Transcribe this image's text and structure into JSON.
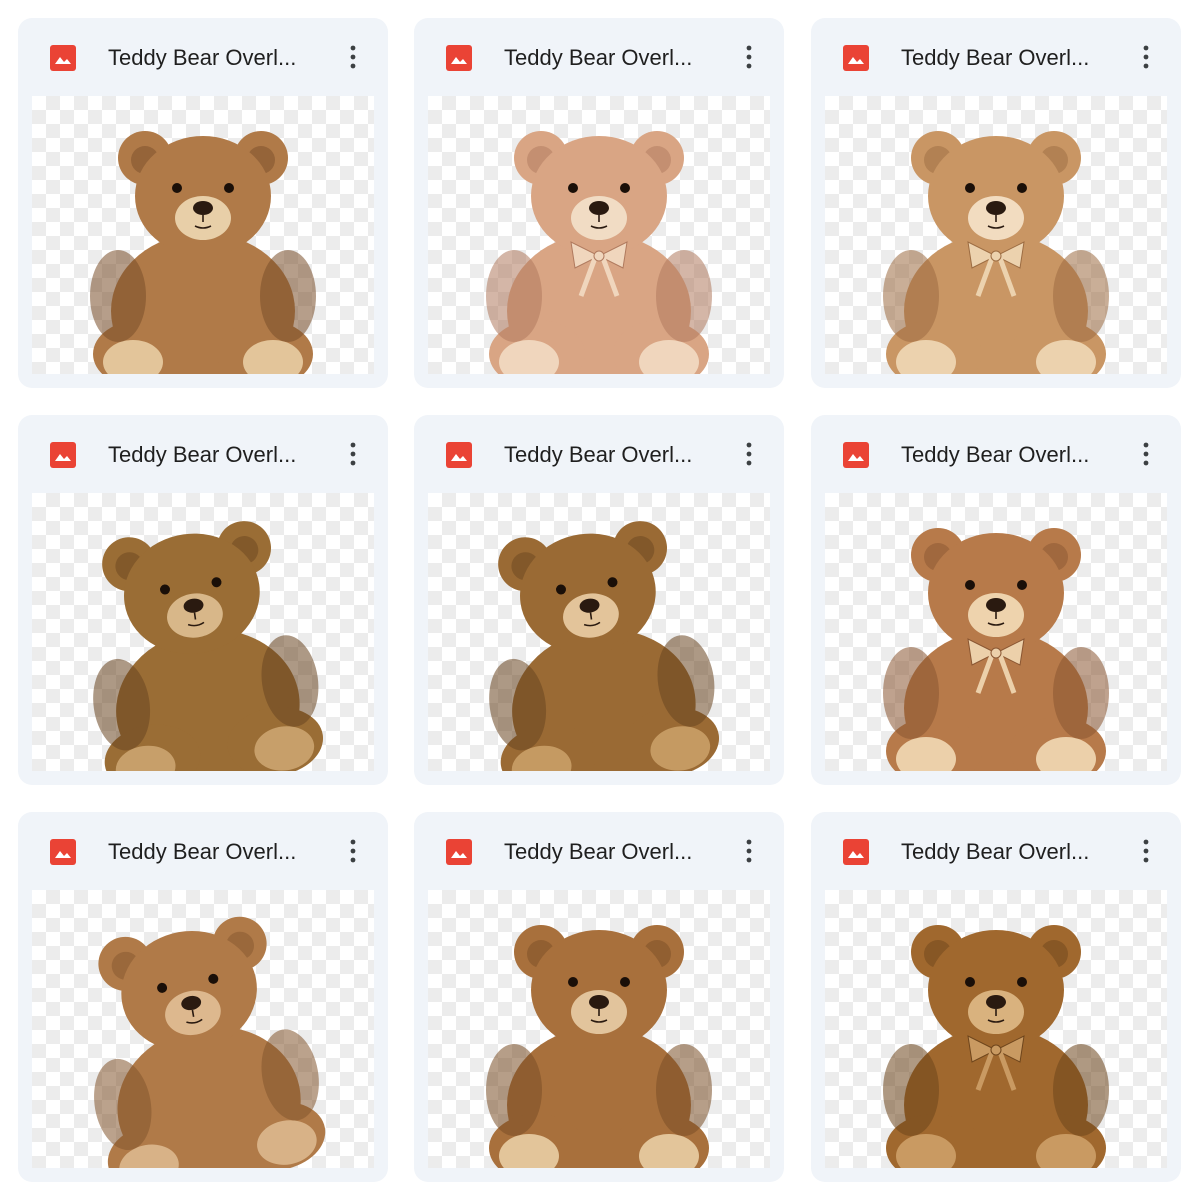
{
  "files": [
    {
      "title": "Teddy Bear Overl...",
      "fur": "#b07a48",
      "dark": "#7a4e2a",
      "muzzle": "#e8cfa8",
      "pad": "#e3c59a",
      "bow": false,
      "pose": "front"
    },
    {
      "title": "Teddy Bear Overl...",
      "fur": "#d9a584",
      "dark": "#b07a5e",
      "muzzle": "#f1dcc4",
      "pad": "#f0d6bd",
      "bow": true,
      "pose": "front"
    },
    {
      "title": "Teddy Bear Overl...",
      "fur": "#c99664",
      "dark": "#9c6c42",
      "muzzle": "#f2dcc0",
      "pad": "#ecd2ae",
      "bow": true,
      "pose": "front"
    },
    {
      "title": "Teddy Bear Overl...",
      "fur": "#9a6d35",
      "dark": "#6a4620",
      "muzzle": "#d8b789",
      "pad": "#c79f6a",
      "bow": false,
      "pose": "lounge"
    },
    {
      "title": "Teddy Bear Overl...",
      "fur": "#9a6a34",
      "dark": "#6a4620",
      "muzzle": "#e3c49a",
      "pad": "#c59a62",
      "bow": false,
      "pose": "lounge"
    },
    {
      "title": "Teddy Bear Overl...",
      "fur": "#b77a4a",
      "dark": "#8a5632",
      "muzzle": "#eed3ad",
      "pad": "#ecd0aa",
      "bow": true,
      "pose": "front"
    },
    {
      "title": "Teddy Bear Overl...",
      "fur": "#b07a48",
      "dark": "#84562e",
      "muzzle": "#ddb88e",
      "pad": "#d8b287",
      "bow": false,
      "pose": "lean"
    },
    {
      "title": "Teddy Bear Overl...",
      "fur": "#a8703c",
      "dark": "#7a4e26",
      "muzzle": "#e2c49c",
      "pad": "#e3c59a",
      "bow": false,
      "pose": "front"
    },
    {
      "title": "Teddy Bear Overl...",
      "fur": "#a0682e",
      "dark": "#6e451c",
      "muzzle": "#d9b27e",
      "pad": "#c99a62",
      "bow": true,
      "pose": "front"
    }
  ],
  "icons": {
    "file_type": "image-file-icon",
    "menu": "more-vertical-icon"
  },
  "colors": {
    "card_bg": "#f0f4f9",
    "icon_red": "#ea4335",
    "text": "#1f1f1f"
  }
}
